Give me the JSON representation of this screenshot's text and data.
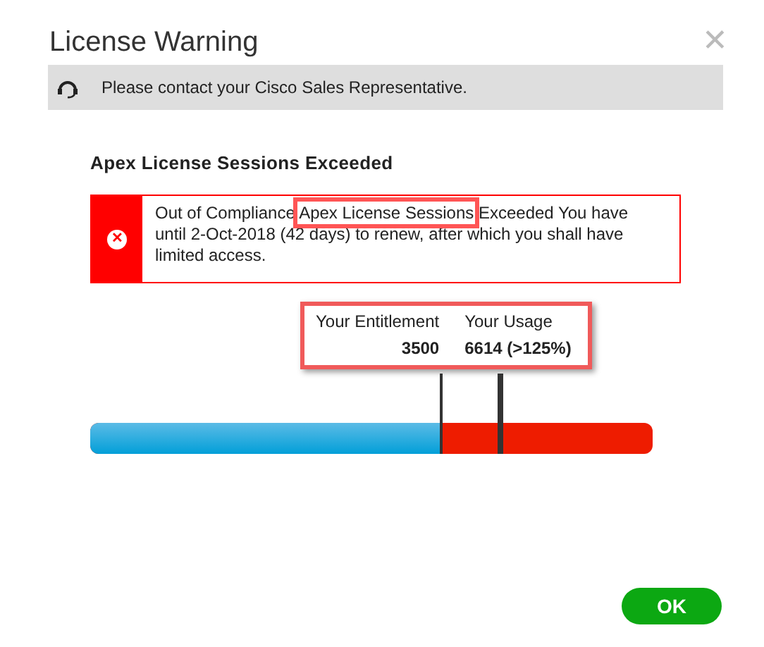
{
  "window": {
    "title": "License Warning",
    "close": "✕"
  },
  "banner": {
    "text": "Please contact your Cisco Sales Representative."
  },
  "heading": "Apex License Sessions Exceeded",
  "error": {
    "icon": "✕",
    "parts": [
      {
        "text": "Out of Compliance ",
        "highlighted": false
      },
      {
        "text": "Apex License Sessions",
        "highlighted": true
      },
      {
        "text": " Exceeded You have until 2-Oct-2018 (42 days) to renew, after which you shall have limited access.",
        "highlighted": false
      }
    ]
  },
  "stats": {
    "highlighted": true,
    "items": [
      {
        "label": "Your Entitlement",
        "value": "3500"
      },
      {
        "label": "Your Usage",
        "value": "6614 (>125%)"
      }
    ]
  },
  "usage_bar": {
    "level": 0.624,
    "usage_marker": {
      "level": 0.73
    }
  },
  "buttons": [
    {
      "label": "OK"
    }
  ]
}
